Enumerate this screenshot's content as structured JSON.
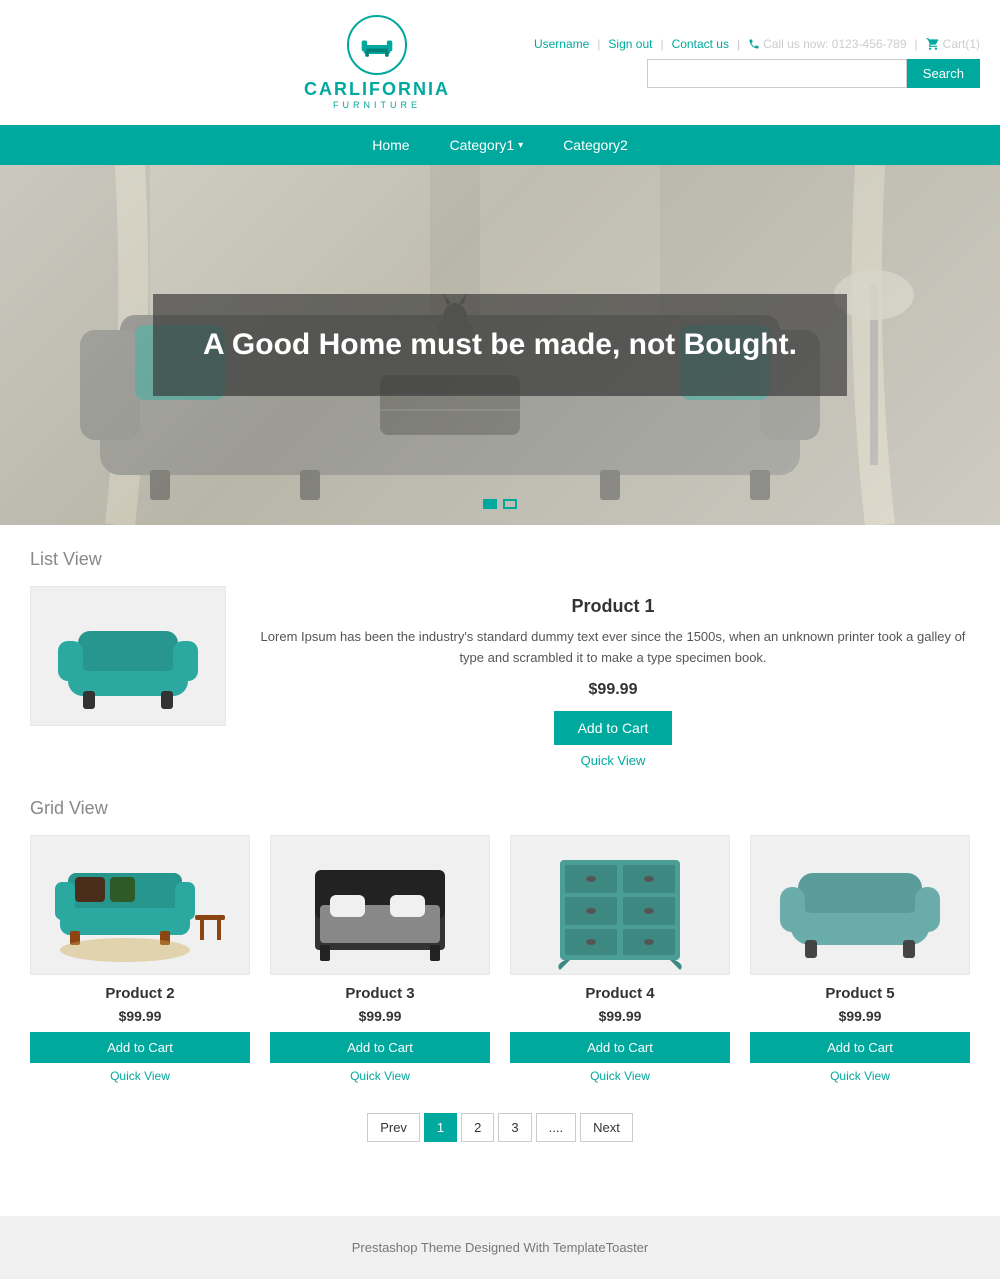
{
  "header": {
    "logo_name": "CARLIFORNIA",
    "logo_sub": "FURNITURE",
    "links": {
      "username": "Username",
      "sign_out": "Sign out",
      "contact": "Contact us",
      "phone": "Call us now: 0123-456-789",
      "cart": "Cart(1)"
    },
    "search_placeholder": "",
    "search_button": "Search"
  },
  "nav": {
    "items": [
      {
        "label": "Home",
        "has_dropdown": false
      },
      {
        "label": "Category1",
        "has_dropdown": true
      },
      {
        "label": "Category2",
        "has_dropdown": false
      }
    ]
  },
  "hero": {
    "text": "A Good Home must be made, not Bought.",
    "dots": [
      {
        "active": true
      },
      {
        "active": false
      }
    ]
  },
  "list_view": {
    "title": "List View",
    "product": {
      "name": "Product 1",
      "description": "Lorem Ipsum has been the industry's standard dummy text ever since the 1500s, when an unknown printer took a galley of type and scrambled it to make a type specimen book.",
      "price": "$99.99",
      "add_to_cart": "Add to Cart",
      "quick_view": "Quick View"
    }
  },
  "grid_view": {
    "title": "Grid View",
    "products": [
      {
        "name": "Product 2",
        "price": "$99.99",
        "add_to_cart": "Add to Cart",
        "quick_view": "Quick View"
      },
      {
        "name": "Product 3",
        "price": "$99.99",
        "add_to_cart": "Add to Cart",
        "quick_view": "Quick View"
      },
      {
        "name": "Product 4",
        "price": "$99.99",
        "add_to_cart": "Add to Cart",
        "quick_view": "Quick View"
      },
      {
        "name": "Product 5",
        "price": "$99.99",
        "add_to_cart": "Add to Cart",
        "quick_view": "Quick View"
      }
    ]
  },
  "pagination": {
    "prev": "Prev",
    "pages": [
      "1",
      "2",
      "3",
      "...."
    ],
    "next": "Next",
    "active_page": "1"
  },
  "footer": {
    "text": "Prestashop Theme Designed With TemplateToaster"
  },
  "colors": {
    "primary": "#00a99d",
    "text_muted": "#888888"
  }
}
